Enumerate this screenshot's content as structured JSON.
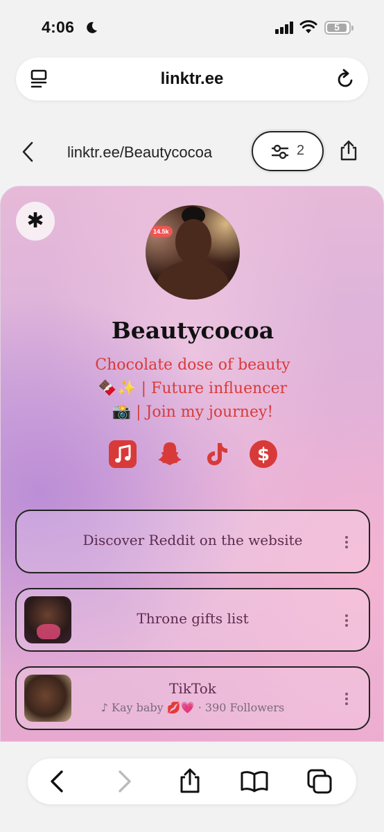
{
  "status": {
    "time": "4:06",
    "battery": "5"
  },
  "browser": {
    "domain": "linktr.ee"
  },
  "linktree_bar": {
    "url": "linktr.ee/Beautycocoa",
    "filter_count": "2"
  },
  "profile": {
    "avatar_tag": "14.5k",
    "name": "Beautycocoa",
    "bio_lines": [
      "Chocolate dose of beauty",
      "🍫✨ | Future influencer",
      "📸 | Join my journey!"
    ],
    "social_icons": [
      "apple-music-icon",
      "snapchat-icon",
      "tiktok-icon",
      "cash-app-icon"
    ],
    "accent_color": "#d83a3a"
  },
  "links": [
    {
      "title": "Discover Reddit on the website"
    },
    {
      "title": "Throne gifts list"
    },
    {
      "title": "TikTok",
      "subtitle": "♪ Kay baby 💋💗 · 390 Followers"
    }
  ]
}
